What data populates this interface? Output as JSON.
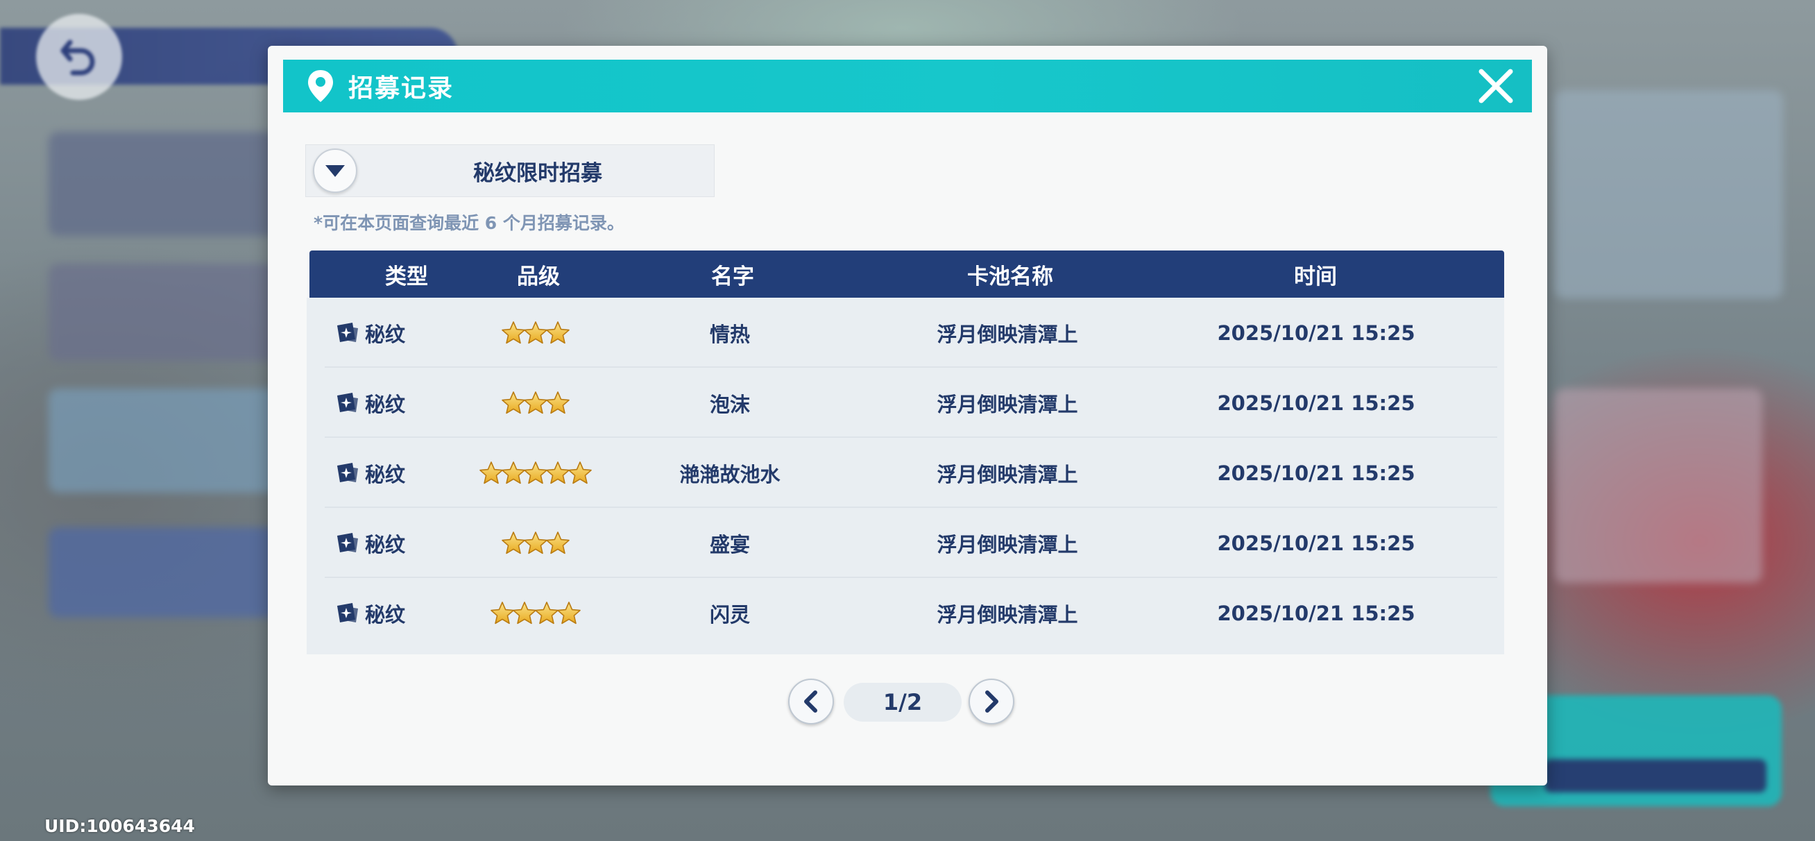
{
  "app": {
    "uid_text": "UID:100643644"
  },
  "dialog": {
    "title": "招募记录",
    "pool_selector": {
      "selected": "秘纹限时招募"
    },
    "hint": "*可在本页面查询最近 6 个月招募记录。",
    "columns": [
      "类型",
      "品级",
      "名字",
      "卡池名称",
      "时间"
    ],
    "rows": [
      {
        "type": "秘纹",
        "stars": 3,
        "name": "情热",
        "pool": "浮月倒映清潭上",
        "time": "2025/10/21 15:25"
      },
      {
        "type": "秘纹",
        "stars": 3,
        "name": "泡沫",
        "pool": "浮月倒映清潭上",
        "time": "2025/10/21 15:25"
      },
      {
        "type": "秘纹",
        "stars": 5,
        "name": "滟滟故池水",
        "pool": "浮月倒映清潭上",
        "time": "2025/10/21 15:25"
      },
      {
        "type": "秘纹",
        "stars": 3,
        "name": "盛宴",
        "pool": "浮月倒映清潭上",
        "time": "2025/10/21 15:25"
      },
      {
        "type": "秘纹",
        "stars": 4,
        "name": "闪灵",
        "pool": "浮月倒映清潭上",
        "time": "2025/10/21 15:25"
      }
    ],
    "pagination": {
      "current": 1,
      "total": 2,
      "label": "1/2"
    }
  },
  "colors": {
    "header_teal": "#12c4c9",
    "table_header_navy": "#223e79",
    "text_navy": "#233a6a",
    "hint_text": "#7f95b4",
    "star_gold": "#f2c531"
  },
  "icons": {
    "header": "location-pin-icon",
    "close": "close-icon",
    "dropdown": "chevron-down-icon",
    "type": "secret-pattern-card-icon",
    "rating": "star-icon",
    "prev": "chevron-left-icon",
    "next": "chevron-right-icon",
    "back": "back-arrow-icon"
  }
}
